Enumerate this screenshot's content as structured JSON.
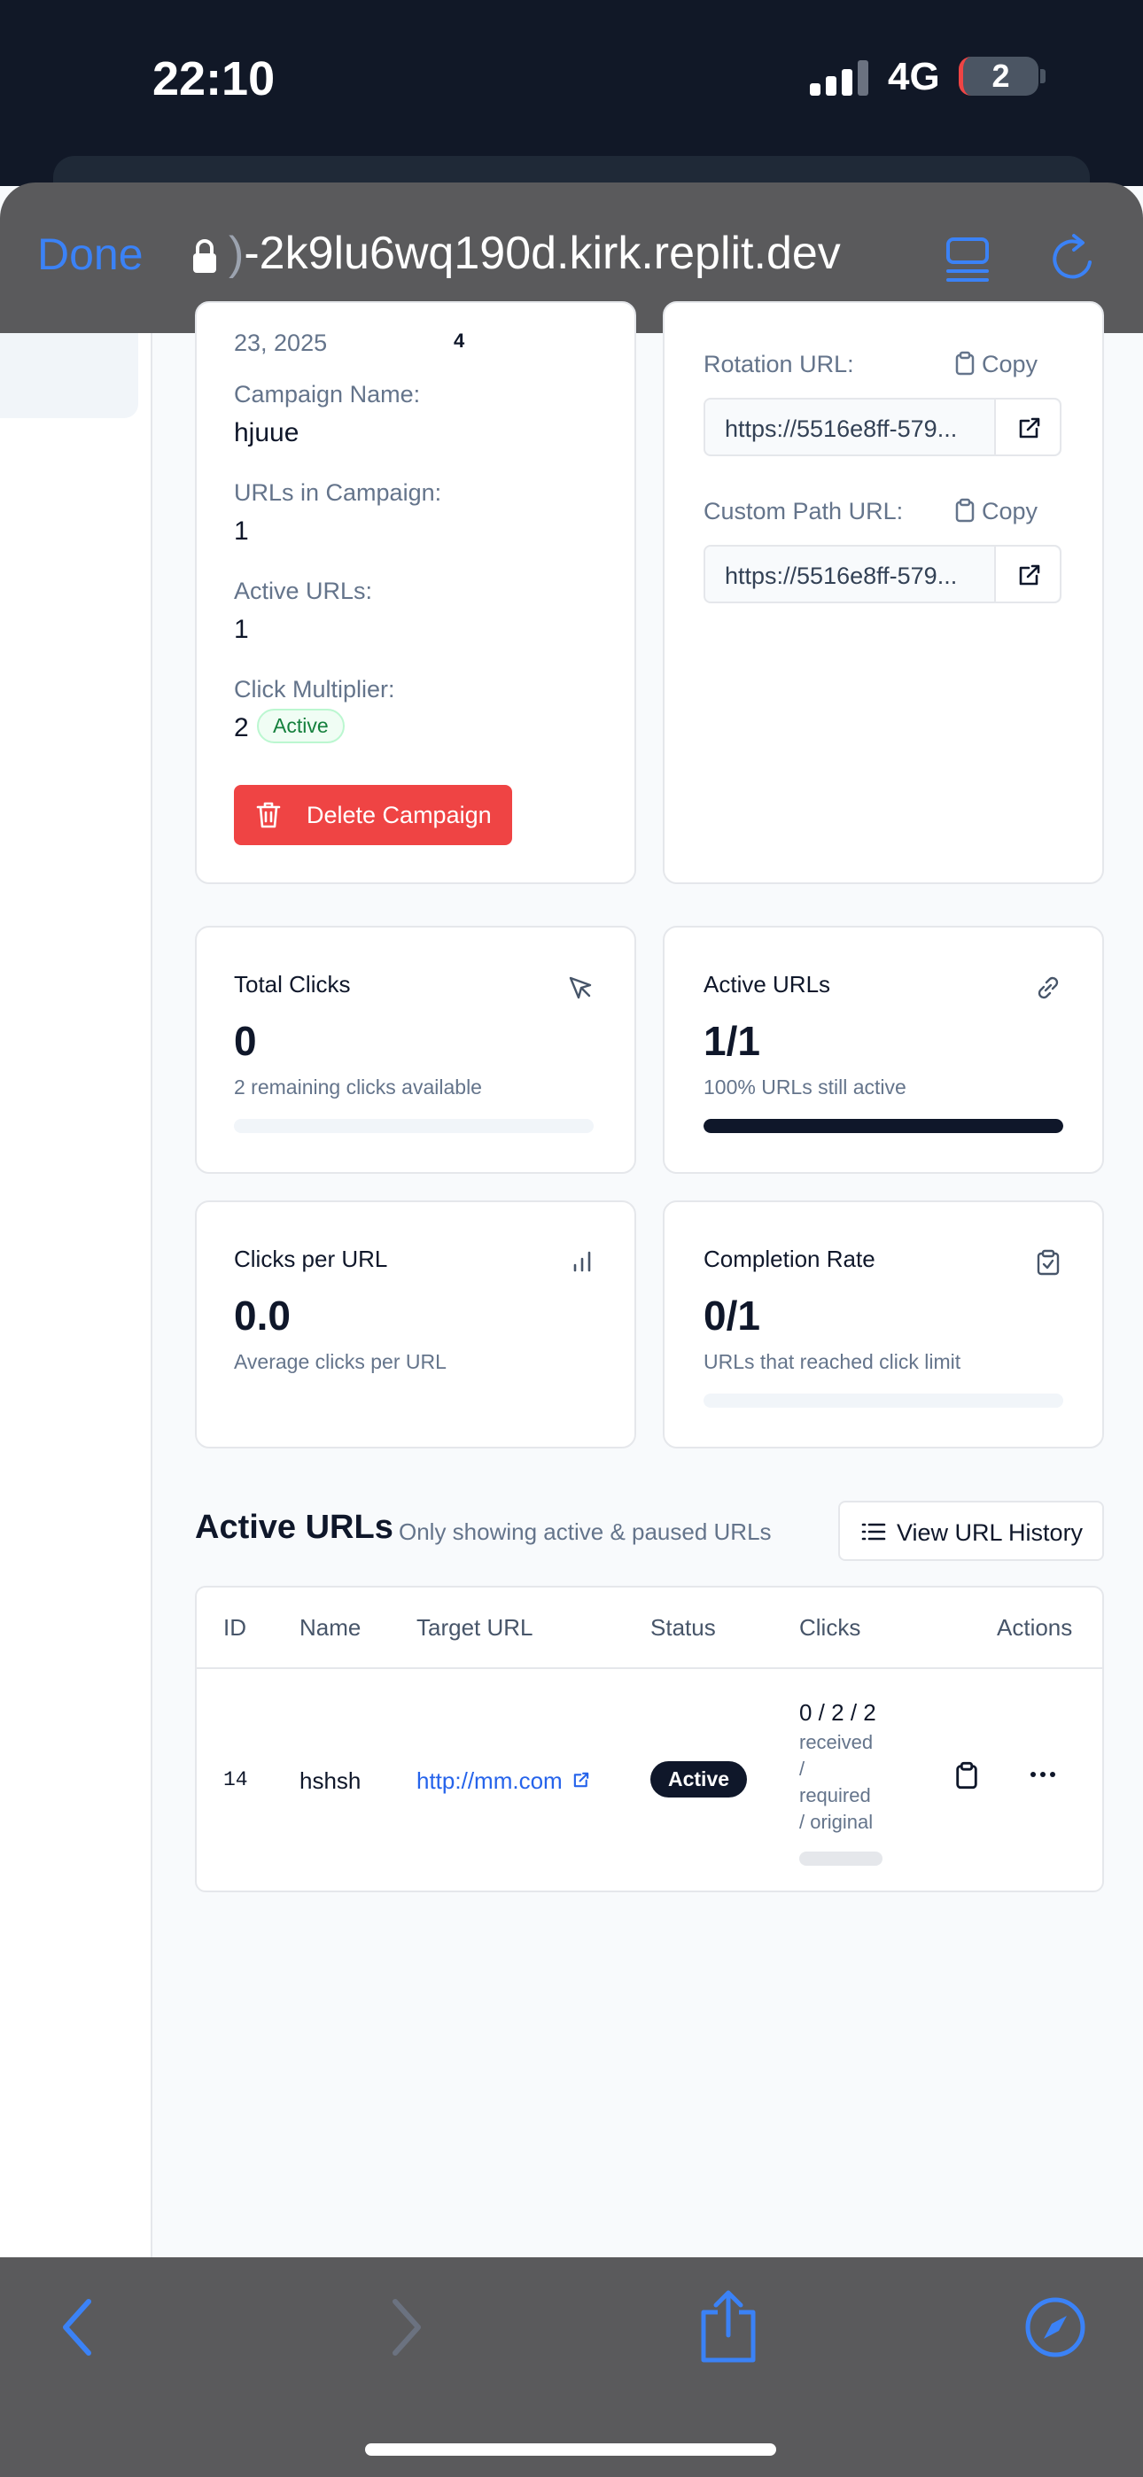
{
  "status_bar": {
    "time": "22:10",
    "network": "4G",
    "battery": "2"
  },
  "browser": {
    "done_label": "Done",
    "url_faded": ")",
    "url_text": "-2k9lu6wq190d.kirk.replit.dev"
  },
  "campaign_card": {
    "date_fragment": "23, 2025",
    "count_fragment": "4",
    "name_label": "Campaign Name:",
    "name_value": "hjuue",
    "urls_label": "URLs in Campaign:",
    "urls_value": "1",
    "active_label": "Active URLs:",
    "active_value": "1",
    "multiplier_label": "Click Multiplier:",
    "multiplier_value": "2",
    "multiplier_badge": "Active",
    "delete_label": "Delete Campaign"
  },
  "urls_card": {
    "rotation_label": "Rotation URL:",
    "rotation_copy": "Copy",
    "rotation_url": "https://5516e8ff-579...",
    "custom_label": "Custom Path URL:",
    "custom_copy": "Copy",
    "custom_url": "https://5516e8ff-579..."
  },
  "stats": {
    "total_clicks": {
      "title": "Total Clicks",
      "value": "0",
      "sub": "2 remaining clicks available",
      "progress": 0
    },
    "active_urls": {
      "title": "Active URLs",
      "value": "1/1",
      "sub": "100% URLs still active",
      "progress": 1.0
    },
    "clicks_per_url": {
      "title": "Clicks per URL",
      "value": "0.0",
      "sub": "Average clicks per URL"
    },
    "completion_rate": {
      "title": "Completion Rate",
      "value": "0/1",
      "sub": "URLs that reached click limit",
      "progress": 0
    }
  },
  "active_urls_section": {
    "title": "Active URLs",
    "subtitle": "Only showing active & paused URLs",
    "history_button": "View URL History",
    "columns": [
      "ID",
      "Name",
      "Target URL",
      "Status",
      "Clicks",
      "Actions"
    ],
    "rows": [
      {
        "id": "14",
        "name": "hshsh",
        "target_url": "http://mm.com",
        "status": "Active",
        "clicks": "0 / 2 / 2",
        "clicks_sub_1": "received",
        "clicks_sub_2": "/",
        "clicks_sub_3": "required",
        "clicks_sub_4": "/ original",
        "progress": 0
      }
    ]
  },
  "colors": {
    "accent": "#3b82f6",
    "danger": "#ef4444",
    "dark": "#0f172a",
    "success": "#15803d"
  }
}
